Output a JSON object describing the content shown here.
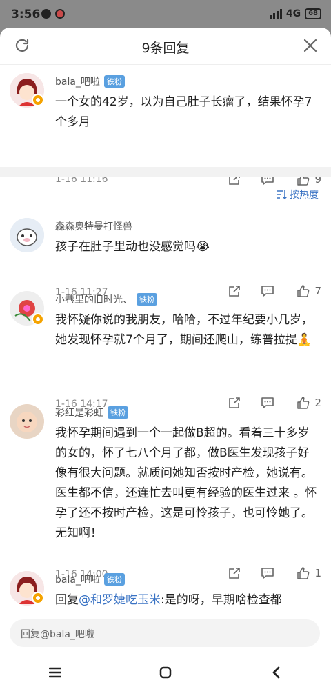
{
  "status_bar": {
    "time": "3:56",
    "network": "4G",
    "battery": "68"
  },
  "sheet": {
    "title": "9条回复",
    "sort_label": "按热度"
  },
  "comments": [
    {
      "name": "bala_吧啦",
      "badge": "铁粉",
      "text": "一个女的42岁，以为自己肚子长瘤了，结果怀孕7个多月",
      "time": "1-16 11:16",
      "likes": "9"
    },
    {
      "name": "森森奥特曼打怪兽",
      "badge": "",
      "text": "孩子在肚子里动也没感觉吗😭",
      "time": "1-16 11:27",
      "likes": "7"
    },
    {
      "name": "小巷里的旧时光、",
      "badge": "铁粉",
      "text": "我怀疑你说的我朋友，哈哈，不过年纪要小几岁，她发现怀孕就7个月了，期间还爬山，练普拉提🧘",
      "time": "1-16 14:17",
      "likes": "2"
    },
    {
      "name": "彩红是彩虹",
      "badge": "铁粉",
      "text": "我怀孕期间遇到一个一起做B超的。看着三十多岁的女的，怀了七八个月了都，做B医生发现孩子好像有很大问题。就质问她知否按时产检，她说有。医生都不信，还连忙去叫更有经验的医生过来 。怀孕了还不按时产检，这是可怜孩子，也可怜她了。无知啊！",
      "time": "1-16 14:00",
      "likes": "1"
    },
    {
      "name": "bala_吧啦",
      "badge": "铁粉",
      "text_prefix": "回复",
      "mention": "@和罗婕吃玉米",
      "text": ":是的呀，早期啥检查都"
    }
  ],
  "reply_bar": {
    "placeholder": "回复@bala_吧啦"
  },
  "colors": {
    "accent_blue": "#3a73c4",
    "badge_blue": "#5aa0e0",
    "vip_orange": "#f5a300"
  }
}
